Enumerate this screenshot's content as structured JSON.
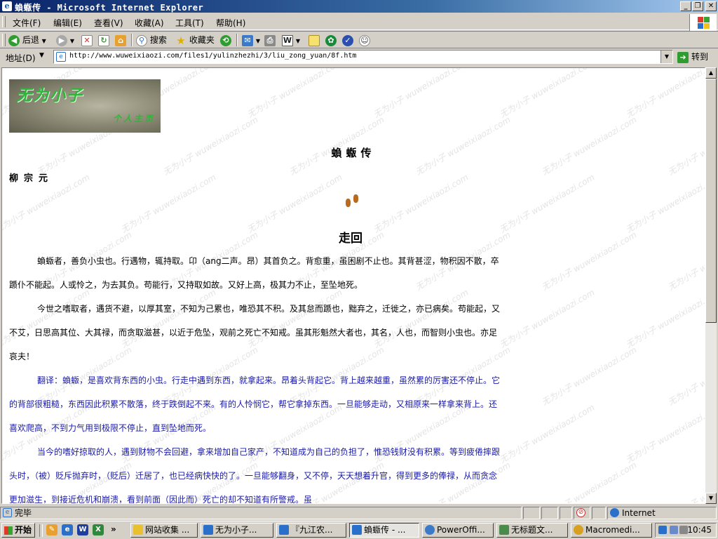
{
  "window": {
    "title": "蝜蝂传 - Microsoft Internet Explorer",
    "minimize": "_",
    "restore": "❐",
    "close": "✕"
  },
  "menu": [
    "文件(F)",
    "编辑(E)",
    "查看(V)",
    "收藏(A)",
    "工具(T)",
    "帮助(H)"
  ],
  "toolbar": {
    "back": "后退",
    "search": "搜索",
    "favorites": "收藏夹"
  },
  "address": {
    "label": "地址(D)",
    "url": "http://www.wuweixiaozi.com/files1/yulinzhezhi/3/liu_zong_yuan/8f.htm",
    "go": "转到"
  },
  "page": {
    "logo_title": "无为小子",
    "logo_subtitle": "个人主页",
    "watermark": "无为小子 wuweixiaozi.com",
    "title": "蝜蝂传",
    "author": "柳宗元",
    "walk_label": "走回",
    "original": [
      "蝜蝂者，善负小虫也。行遇物，辄持取。卬（ang二声。昂）其首负之。背愈重，虽困剧不止也。其背甚涩，物积因不散，卒踬仆不能起。人或怜之，为去其负。苟能行，又持取如故。又好上高，极其力不止，至坠地死。",
      "今世之嗜取者，遇货不避，以厚其室，不知为己累也，唯恐其不积。及其怠而踬也，黜弃之，迁徙之，亦已病矣。苟能起，又不艾，日思高其位、大其禄，而贪取滋甚，以近于危坠，观前之死亡不知戒。虽其形魁然大者也，其名，人也，而智则小虫也。亦足哀夫！"
    ],
    "translation": [
      "翻译：蝜蝂，是喜欢背东西的小虫。行走中遇到东西，就拿起来。昂着头背起它。背上越来越重，虽然累的厉害还不停止。它的背部很粗糙，东西因此积累不散落，终于跌倒起不来。有的人怜悯它，帮它拿掉东西。一旦能够走动，又相原来一样拿来背上。还喜欢爬高，不到力气用到极限不停止，直到坠地而死。",
      "当今的嗜好掠取的人，遇到财物不会回避，拿来增加自己家产，不知道成为自己的负担了，惟恐钱财没有积累。等到疲倦摔跟头时，（被）贬斥抛弃时，（贬后）迁居了，也已经病快快的了。一旦能够翻身，又不停，天天想着升官，得到更多的俸禄，从而贪念更加滋生，到接近危机和崩溃，看到前面（因此而）死亡的却不知道有所警戒。虽"
    ]
  },
  "status": {
    "text": "完毕",
    "zone": "Internet"
  },
  "taskbar": {
    "start": "开始",
    "tasks": [
      "网站收集 ...",
      "无为小子...",
      "『九江农...",
      "蝜蝂传 - ...",
      "PowerOffi...",
      "无标题文...",
      "Macromedi..."
    ],
    "clock": "10:45"
  }
}
